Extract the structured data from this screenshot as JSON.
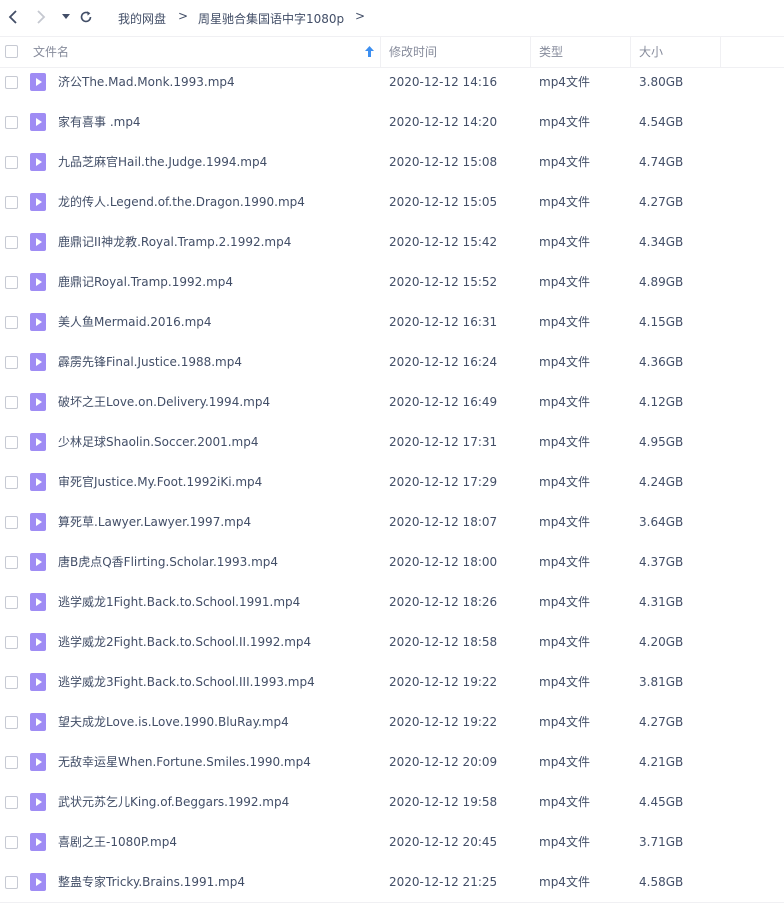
{
  "breadcrumb": {
    "root": "我的网盘",
    "folder": "周星驰合集国语中字1080p",
    "separator": ">"
  },
  "columns": {
    "name": "文件名",
    "modified": "修改时间",
    "type": "类型",
    "size": "大小"
  },
  "files": [
    {
      "name": "济公The.Mad.Monk.1993.mp4",
      "modified": "2020-12-12 14:16",
      "type": "mp4文件",
      "size": "3.80GB"
    },
    {
      "name": "家有喜事 .mp4",
      "modified": "2020-12-12 14:20",
      "type": "mp4文件",
      "size": "4.54GB"
    },
    {
      "name": "九品芝麻官Hail.the.Judge.1994.mp4",
      "modified": "2020-12-12 15:08",
      "type": "mp4文件",
      "size": "4.74GB"
    },
    {
      "name": "龙的传人.Legend.of.the.Dragon.1990.mp4",
      "modified": "2020-12-12 15:05",
      "type": "mp4文件",
      "size": "4.27GB"
    },
    {
      "name": "鹿鼎记II神龙教.Royal.Tramp.2.1992.mp4",
      "modified": "2020-12-12 15:42",
      "type": "mp4文件",
      "size": "4.34GB"
    },
    {
      "name": "鹿鼎记Royal.Tramp.1992.mp4",
      "modified": "2020-12-12 15:52",
      "type": "mp4文件",
      "size": "4.89GB"
    },
    {
      "name": "美人鱼Mermaid.2016.mp4",
      "modified": "2020-12-12 16:31",
      "type": "mp4文件",
      "size": "4.15GB"
    },
    {
      "name": "霹雳先锋Final.Justice.1988.mp4",
      "modified": "2020-12-12 16:24",
      "type": "mp4文件",
      "size": "4.36GB"
    },
    {
      "name": "破坏之王Love.on.Delivery.1994.mp4",
      "modified": "2020-12-12 16:49",
      "type": "mp4文件",
      "size": "4.12GB"
    },
    {
      "name": "少林足球Shaolin.Soccer.2001.mp4",
      "modified": "2020-12-12 17:31",
      "type": "mp4文件",
      "size": "4.95GB"
    },
    {
      "name": "审死官Justice.My.Foot.1992iKi.mp4",
      "modified": "2020-12-12 17:29",
      "type": "mp4文件",
      "size": "4.24GB"
    },
    {
      "name": "算死草.Lawyer.Lawyer.1997.mp4",
      "modified": "2020-12-12 18:07",
      "type": "mp4文件",
      "size": "3.64GB"
    },
    {
      "name": "唐B虎点Q香Flirting.Scholar.1993.mp4",
      "modified": "2020-12-12 18:00",
      "type": "mp4文件",
      "size": "4.37GB"
    },
    {
      "name": "逃学威龙1Fight.Back.to.School.1991.mp4",
      "modified": "2020-12-12 18:26",
      "type": "mp4文件",
      "size": "4.31GB"
    },
    {
      "name": "逃学威龙2Fight.Back.to.School.II.1992.mp4",
      "modified": "2020-12-12 18:58",
      "type": "mp4文件",
      "size": "4.20GB"
    },
    {
      "name": "逃学威龙3Fight.Back.to.School.III.1993.mp4",
      "modified": "2020-12-12 19:22",
      "type": "mp4文件",
      "size": "3.81GB"
    },
    {
      "name": "望夫成龙Love.is.Love.1990.BluRay.mp4",
      "modified": "2020-12-12 19:22",
      "type": "mp4文件",
      "size": "4.27GB"
    },
    {
      "name": "无敌幸运星When.Fortune.Smiles.1990.mp4",
      "modified": "2020-12-12 20:09",
      "type": "mp4文件",
      "size": "4.21GB"
    },
    {
      "name": "武状元苏乞儿King.of.Beggars.1992.mp4",
      "modified": "2020-12-12 19:58",
      "type": "mp4文件",
      "size": "4.45GB"
    },
    {
      "name": "喜剧之王-1080P.mp4",
      "modified": "2020-12-12 20:45",
      "type": "mp4文件",
      "size": "3.71GB"
    },
    {
      "name": "整蛊专家Tricky.Brains.1991.mp4",
      "modified": "2020-12-12 21:25",
      "type": "mp4文件",
      "size": "4.58GB"
    }
  ],
  "colors": {
    "file_icon": "#9f8cf4",
    "sort_arrow": "#3d8ff0",
    "text": "#424e67",
    "header_text": "#878c9c"
  }
}
